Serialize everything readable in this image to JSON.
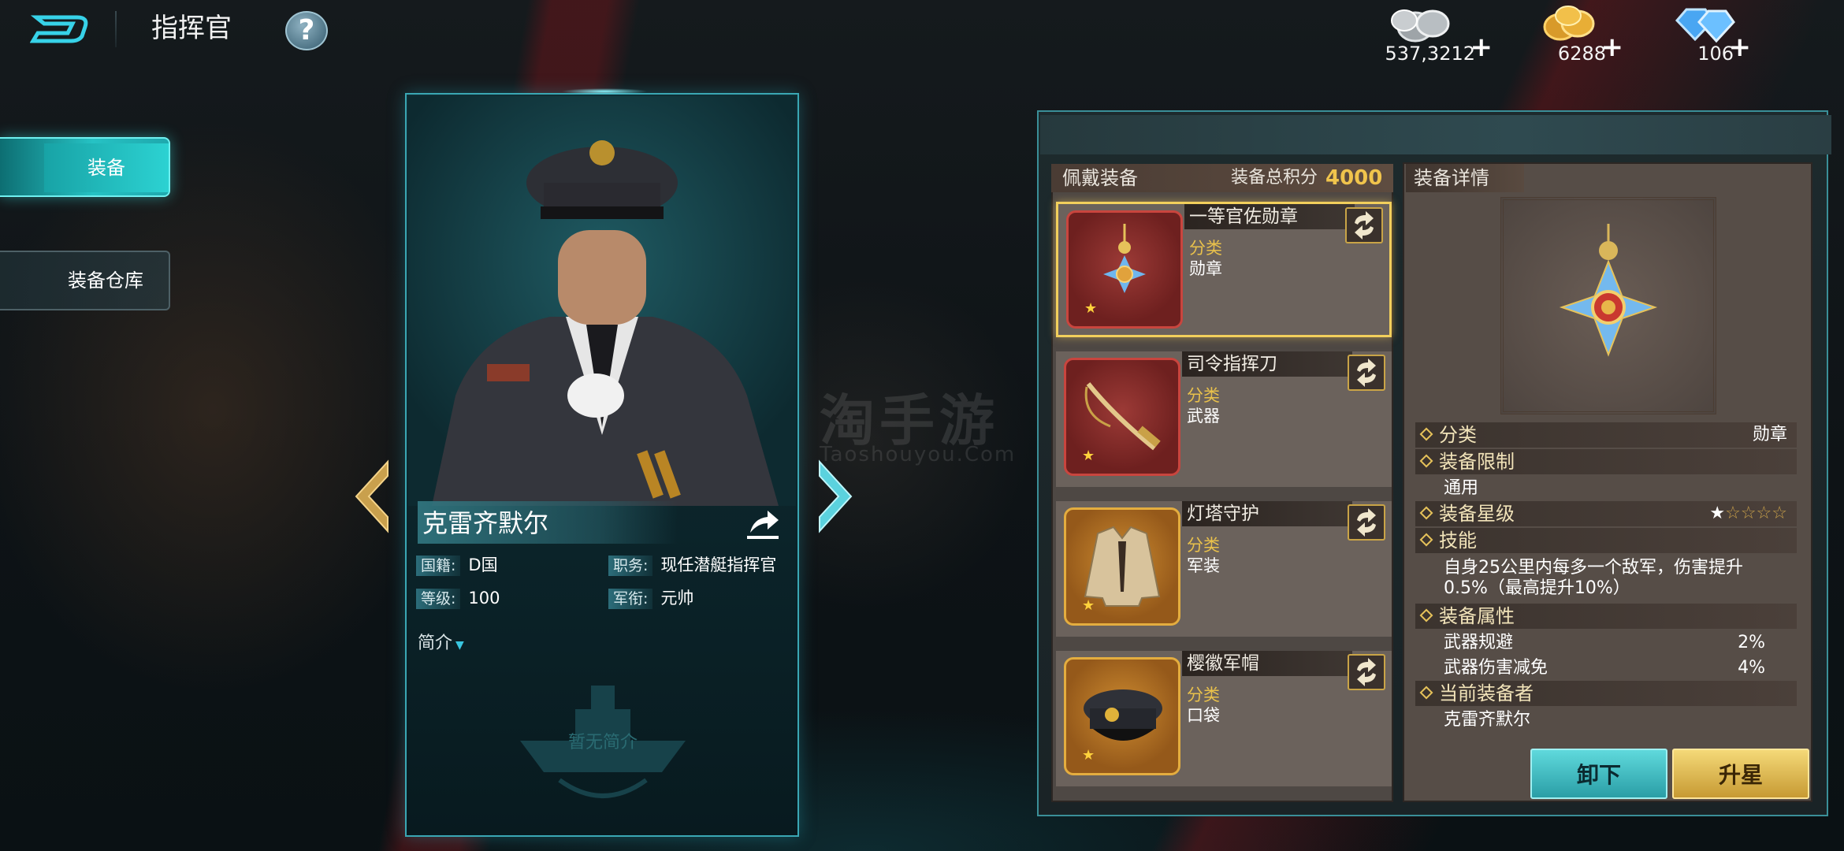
{
  "header": {
    "title": "指挥官",
    "help_label": "?",
    "currencies": [
      {
        "name": "silver",
        "amount": "537,3212"
      },
      {
        "name": "gold",
        "amount": "6288"
      },
      {
        "name": "diamond",
        "amount": "106"
      }
    ],
    "plus": "+"
  },
  "tabs": [
    {
      "label": "装备",
      "active": true
    },
    {
      "label": "装备仓库",
      "active": false
    }
  ],
  "commander": {
    "name": "克雷齐默尔",
    "nationality_label": "国籍:",
    "nationality": "D国",
    "position_label": "职务:",
    "position": "现任潜艇指挥官",
    "level_label": "等级:",
    "level": "100",
    "rank_label": "军衔:",
    "rank": "元帅",
    "intro_label": "简介",
    "no_intro": "暂无简介"
  },
  "worn": {
    "title": "佩戴装备",
    "score_label": "装备总积分",
    "score": "4000",
    "category_label": "分类",
    "items": [
      {
        "name": "一等官佐勋章",
        "category": "勋章",
        "stars": "★",
        "icon": "medal-icon"
      },
      {
        "name": "司令指挥刀",
        "category": "武器",
        "stars": "★",
        "icon": "saber-icon"
      },
      {
        "name": "灯塔守护",
        "category": "军装",
        "stars": "★",
        "icon": "uniform-icon"
      },
      {
        "name": "樱徽军帽",
        "category": "口袋",
        "stars": "★",
        "icon": "cap-icon"
      }
    ]
  },
  "detail": {
    "title": "装备详情",
    "category_label": "分类",
    "category_value": "勋章",
    "restriction_label": "装备限制",
    "restriction_value": "通用",
    "star_label": "装备星级",
    "star_filled": "★",
    "star_empty": "☆☆☆☆",
    "skill_label": "技能",
    "skill_text": "自身25公里内每多一个敌军，伤害提升0.5%（最高提升10%）",
    "attr_label": "装备属性",
    "attrs": [
      {
        "name": "武器规避",
        "value": "2%"
      },
      {
        "name": "武器伤害减免",
        "value": "4%"
      }
    ],
    "wearer_label": "当前装备者",
    "wearer_value": "克雷齐默尔",
    "unequip_label": "卸下",
    "upgrade_label": "升星"
  },
  "watermark": {
    "main": "淘手游",
    "sub": "Taoshouyou.Com"
  },
  "colors": {
    "accent": "#2cd2d2",
    "gold": "#f0c44c",
    "panel": "#564d47"
  }
}
